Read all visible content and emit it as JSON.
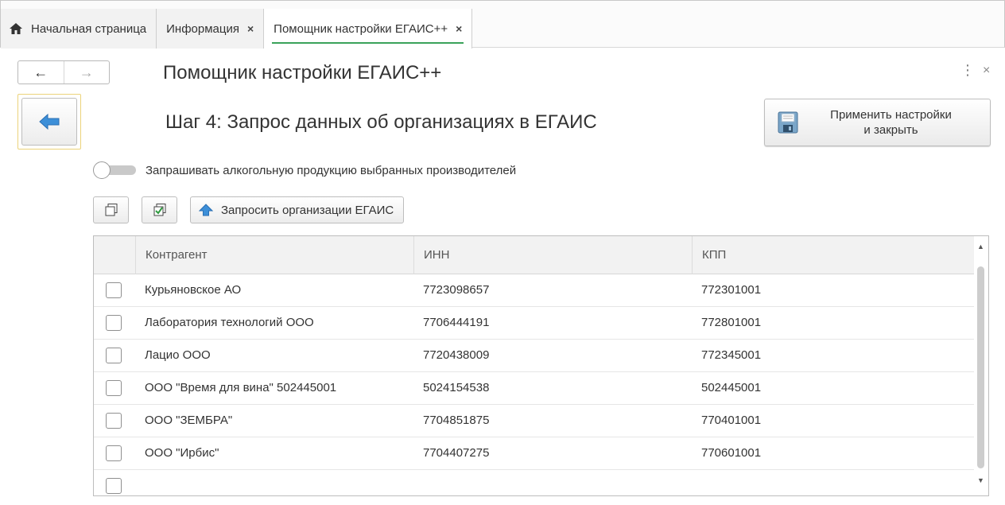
{
  "tabs": [
    {
      "label": "Начальная страница",
      "closable": false
    },
    {
      "label": "Информация",
      "closable": true
    },
    {
      "label": "Помощник настройки ЕГАИС++",
      "closable": true,
      "active": true
    }
  ],
  "tab_close_glyph": "×",
  "nav": {
    "back_glyph": "←",
    "forward_glyph": "→"
  },
  "form": {
    "title": "Помощник настройки ЕГАИС++",
    "more_glyph": "⋮",
    "close_glyph": "×",
    "step_title": "Шаг 4: Запрос данных об организациях в ЕГАИС",
    "apply_button": "Применить настройки и закрыть",
    "toggle_label": "Запрашивать алкогольную продукцию выбранных производителей",
    "toggle_on": false,
    "request_button": "Запросить организации ЕГАИС"
  },
  "icons": {
    "home": "home-icon",
    "back": "blue-left-arrow-icon",
    "save": "floppy-disk-icon",
    "copy": "copy-icon",
    "check_all": "check-all-icon",
    "request": "blue-up-arrow-icon"
  },
  "colors": {
    "accent_green": "#3aa25a",
    "arrow_blue": "#3d8fd8",
    "focus_yellow": "#ecd37a"
  },
  "table": {
    "columns": [
      "Контрагент",
      "ИНН",
      "КПП"
    ],
    "rows": [
      {
        "checked": false,
        "name": "Курьяновское АО",
        "inn": "7723098657",
        "kpp": "772301001"
      },
      {
        "checked": false,
        "name": "Лаборатория технологий ООО",
        "inn": "7706444191",
        "kpp": "772801001"
      },
      {
        "checked": false,
        "name": "Лацио ООО",
        "inn": "7720438009",
        "kpp": "772345001"
      },
      {
        "checked": false,
        "name": "ООО \"Время для вина\" 502445001",
        "inn": "5024154538",
        "kpp": "502445001"
      },
      {
        "checked": false,
        "name": "ООО \"ЗЕМБРА\"",
        "inn": "7704851875",
        "kpp": "770401001"
      },
      {
        "checked": false,
        "name": "ООО \"Ирбис\"",
        "inn": "7704407275",
        "kpp": "770601001"
      }
    ]
  }
}
